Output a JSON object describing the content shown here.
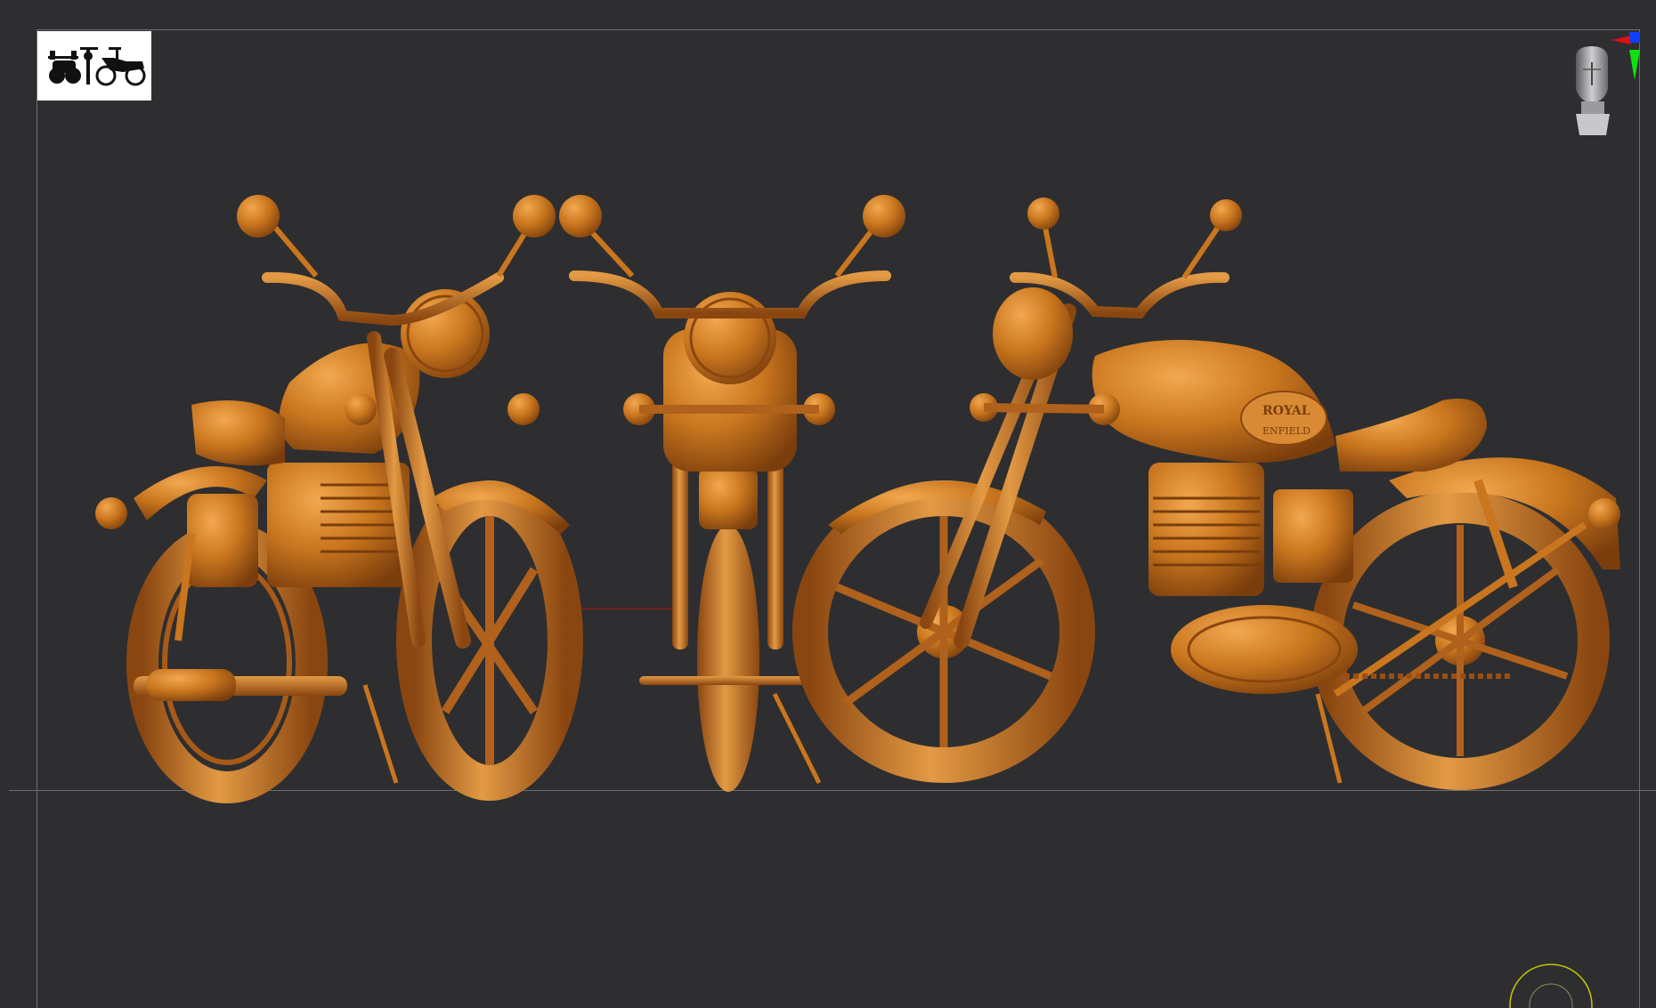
{
  "tank_brand_line1": "ROYAL",
  "tank_brand_line2": "ENFIELD",
  "colors": {
    "background": "#2e2e30",
    "material": "#c9761e",
    "material_light": "#e39a44",
    "material_dark": "#7a3d0c",
    "frame_lines": "#6e6e72",
    "axis_red": "#e01010",
    "axis_green": "#10e010",
    "axis_blue": "#1040ff",
    "nav_circle": "#c8c800"
  },
  "icons": {
    "thumbnail": "motorcycle-silhouettes-thumbnail",
    "gizmo": "head-orientation-gizmo-icon",
    "nav": "navigation-circle-icon"
  }
}
